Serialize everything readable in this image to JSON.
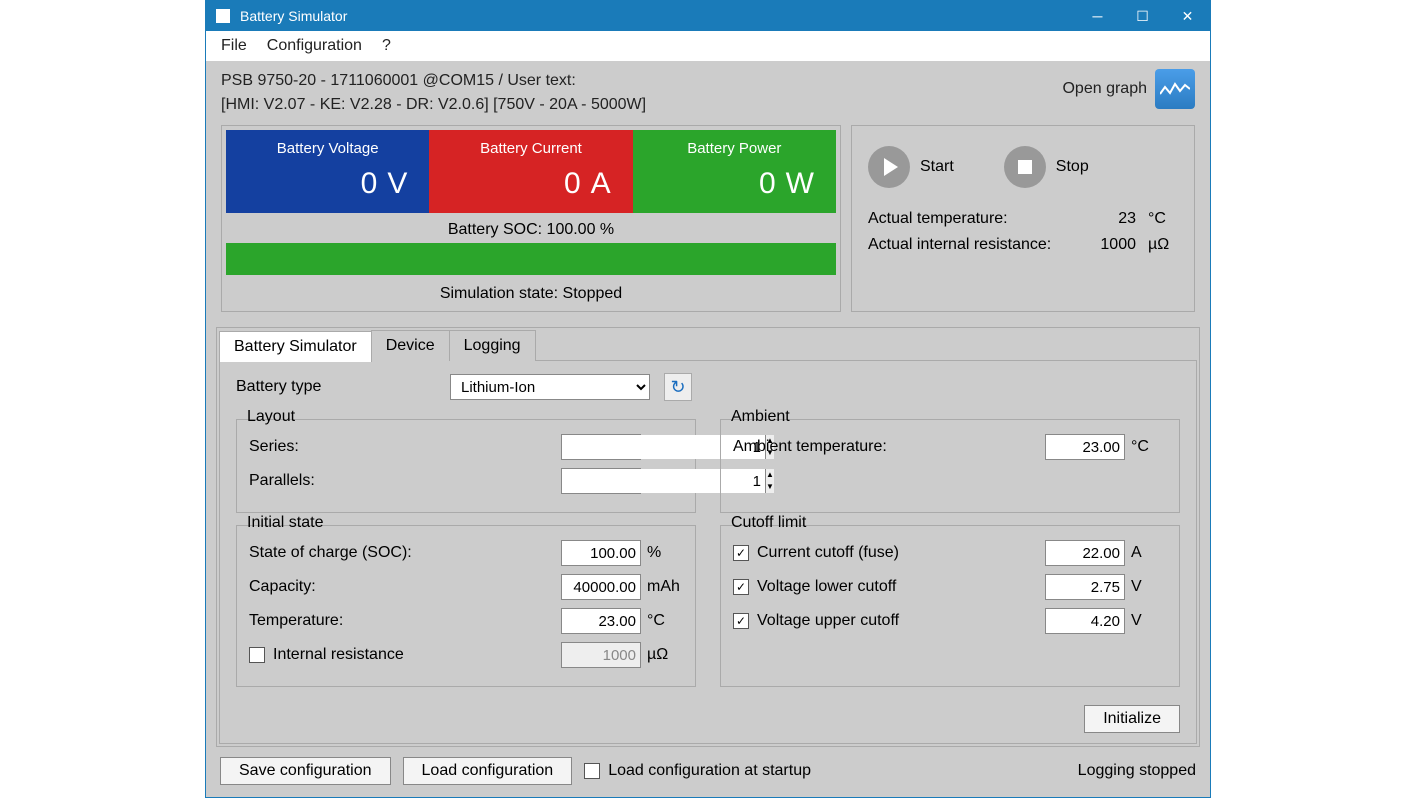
{
  "title": "Battery Simulator",
  "menu": {
    "file": "File",
    "configuration": "Configuration",
    "help": "?"
  },
  "info": {
    "line1": "PSB 9750-20 - 1711060001 @COM15 / User text:",
    "line2": "[HMI: V2.07 - KE: V2.28 - DR: V2.0.6] [750V - 20A - 5000W]",
    "open_graph": "Open graph"
  },
  "meters": {
    "voltage_label": "Battery Voltage",
    "voltage_value": "0",
    "voltage_unit": "V",
    "current_label": "Battery Current",
    "current_value": "0",
    "current_unit": "A",
    "power_label": "Battery Power",
    "power_value": "0",
    "power_unit": "W",
    "soc": "Battery SOC: 100.00 %",
    "sim_state": "Simulation state: Stopped"
  },
  "controls": {
    "start": "Start",
    "stop": "Stop",
    "temp_label": "Actual temperature:",
    "temp_val": "23",
    "temp_unit": "°C",
    "res_label": "Actual internal resistance:",
    "res_val": "1000",
    "res_unit": "µΩ"
  },
  "tabs": {
    "sim": "Battery Simulator",
    "device": "Device",
    "logging": "Logging"
  },
  "battery_type": {
    "label": "Battery type",
    "value": "Lithium-Ion"
  },
  "layout": {
    "legend": "Layout",
    "series_label": "Series:",
    "series_value": "1",
    "parallels_label": "Parallels:",
    "parallels_value": "1"
  },
  "initial": {
    "legend": "Initial state",
    "soc_label": "State of charge (SOC):",
    "soc_value": "100.00",
    "soc_unit": "%",
    "capacity_label": "Capacity:",
    "capacity_value": "40000.00",
    "capacity_unit": "mAh",
    "temp_label": "Temperature:",
    "temp_value": "23.00",
    "temp_unit": "°C",
    "ir_label": "Internal resistance",
    "ir_value": "1000",
    "ir_unit": "µΩ"
  },
  "ambient": {
    "legend": "Ambient",
    "label": "Ambient temperature:",
    "value": "23.00",
    "unit": "°C"
  },
  "cutoff": {
    "legend": "Cutoff limit",
    "current_label": "Current cutoff (fuse)",
    "current_value": "22.00",
    "current_unit": "A",
    "vlow_label": "Voltage lower cutoff",
    "vlow_value": "2.75",
    "vlow_unit": "V",
    "vhigh_label": "Voltage upper cutoff",
    "vhigh_value": "4.20",
    "vhigh_unit": "V"
  },
  "initialize": "Initialize",
  "footer": {
    "save": "Save configuration",
    "load": "Load configuration",
    "load_startup": "Load configuration at startup",
    "logging": "Logging stopped"
  }
}
